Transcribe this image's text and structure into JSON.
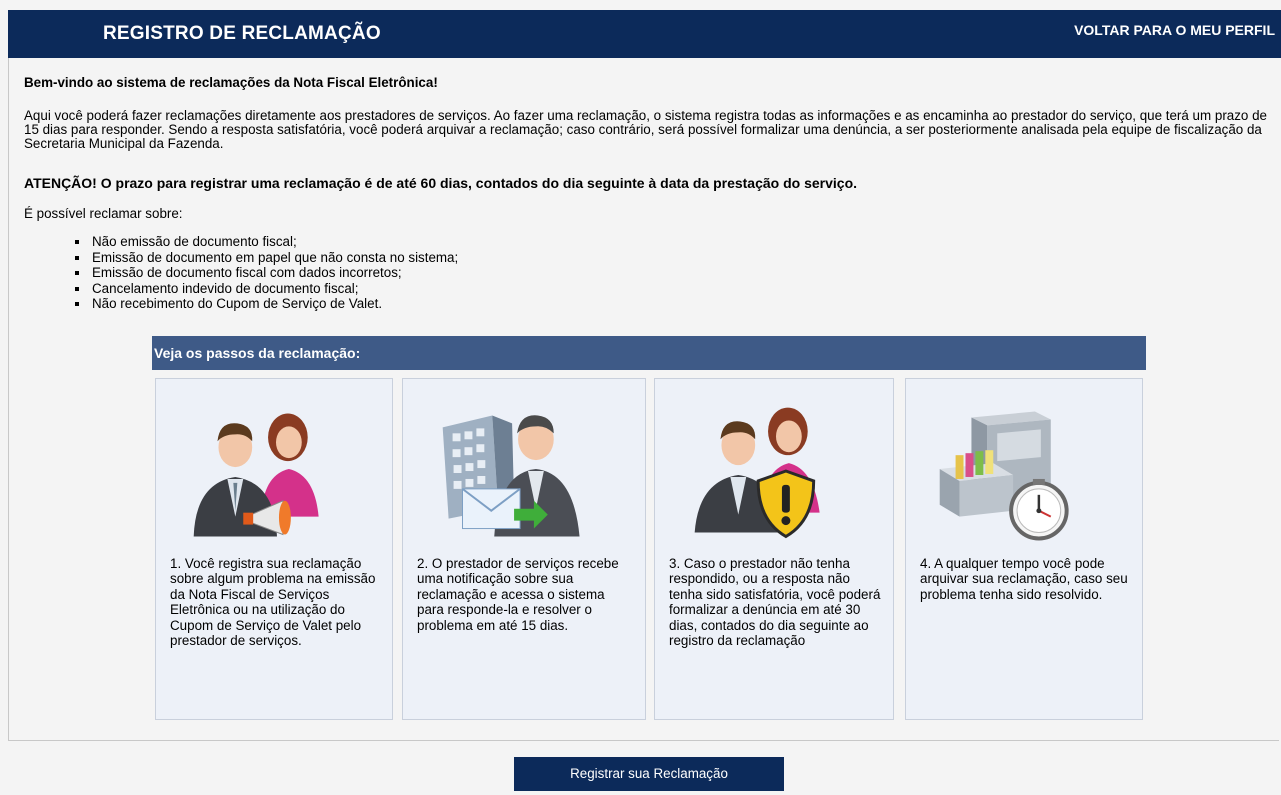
{
  "header": {
    "title": "REGISTRO DE RECLAMAÇÃO",
    "back_link": "VOLTAR PARA O MEU PERFIL"
  },
  "main": {
    "welcome": "Bem-vindo ao sistema de reclamações da Nota Fiscal Eletrônica!",
    "intro": "Aqui você poderá fazer reclamações diretamente aos prestadores de serviços. Ao fazer uma reclamação, o sistema registra todas as informações e as encaminha ao prestador do serviço, que terá um prazo de 15 dias para responder. Sendo a resposta satisfatória, você poderá arquivar a reclamação; caso contrário, será possível formalizar uma denúncia, a ser posteriormente analisada pela equipe de fiscalização da Secretaria Municipal da Fazenda.",
    "attention": "ATENÇÃO! O prazo para registrar uma reclamação é de até 60 dias, contados do dia seguinte à data da prestação do serviço.",
    "possible_label": "É possível reclamar sobre:",
    "items": [
      "Não emissão de documento fiscal;",
      "Emissão de documento em papel que não consta no sistema;",
      "Emissão de documento fiscal com dados incorretos;",
      "Cancelamento indevido de documento fiscal;",
      "Não recebimento do Cupom de Serviço de Valet."
    ],
    "steps_title": "Veja os passos da reclamação:",
    "steps": [
      {
        "icon": "complaint-megaphone-icon",
        "text": "1. Você registra sua reclamação sobre algum problema na emissão da Nota Fiscal de Serviços Eletrônica ou na utilização do Cupom de Serviço de Valet pelo prestador de serviços."
      },
      {
        "icon": "provider-notification-icon",
        "text": "2. O prestador de serviços recebe uma notificação sobre sua reclamação e acessa o sistema para responde-la e resolver o problema em até 15 dias."
      },
      {
        "icon": "warning-shield-icon",
        "text": "3. Caso o prestador não tenha respondido, ou a resposta não tenha sido satisfatória, você poderá formalizar a denúncia em até 30 dias, contados do dia seguinte ao registro da reclamação"
      },
      {
        "icon": "archive-clock-icon",
        "text": "4. A qualquer tempo você pode arquivar sua reclamação, caso seu problema tenha sido resolvido."
      }
    ]
  },
  "footer": {
    "register_button": "Registrar sua Reclamação"
  },
  "colors": {
    "header_bg": "#0c2a5a",
    "steps_bar_bg": "#3e5a87",
    "card_bg": "#edf1f8",
    "page_bg": "#f4f4f4"
  }
}
